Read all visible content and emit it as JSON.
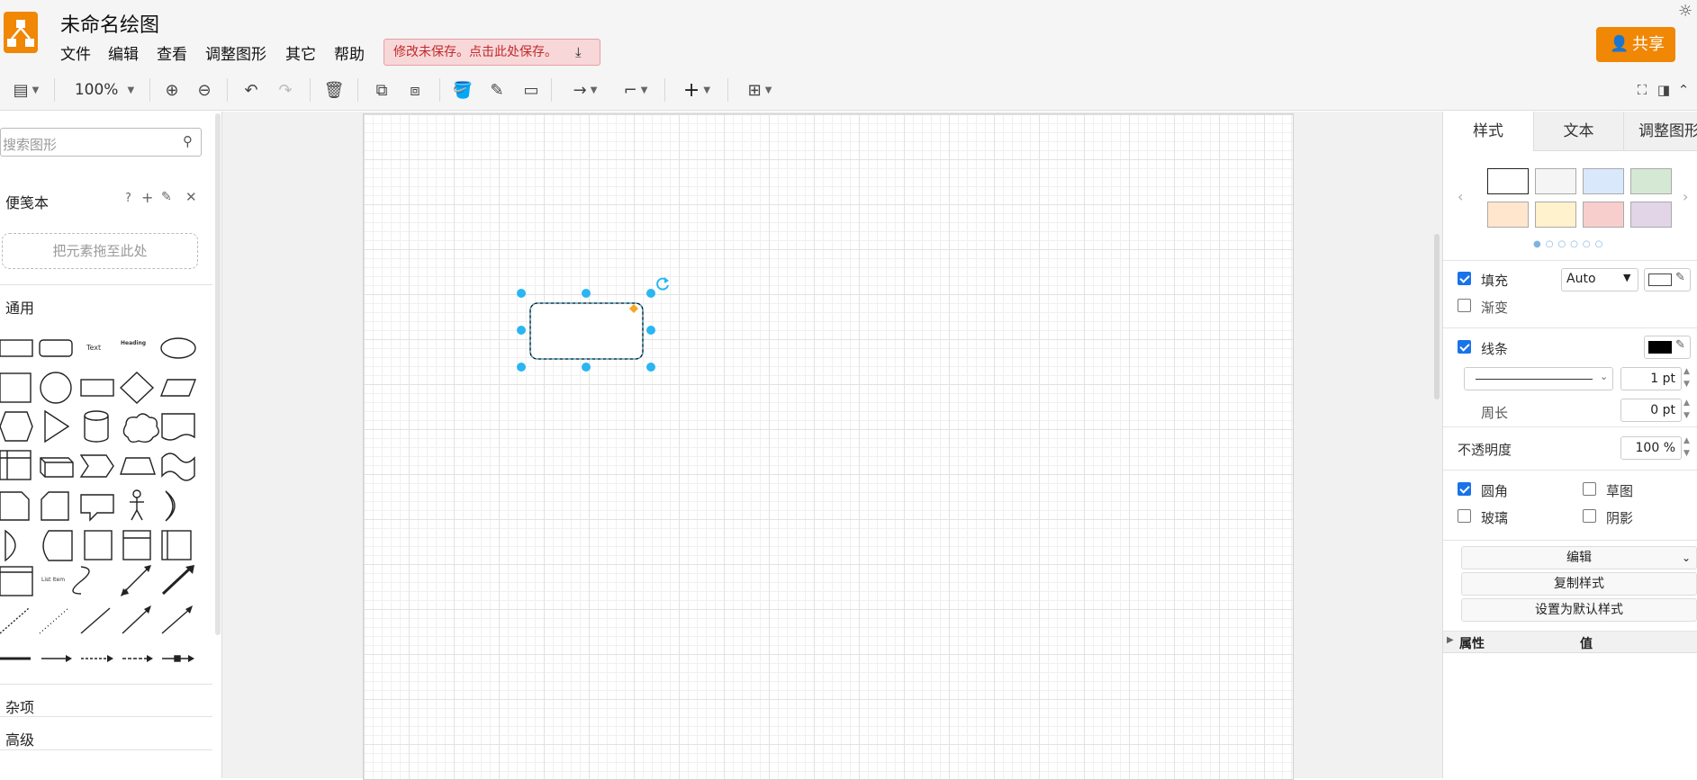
{
  "app": {
    "title": "未命名绘图",
    "menu": [
      "文件",
      "编辑",
      "查看",
      "调整图形",
      "其它",
      "帮助"
    ],
    "unsaved_notice": "修改未保存。点击此处保存。",
    "share_label": "共享"
  },
  "toolbar": {
    "zoom": "100%"
  },
  "left_panel": {
    "search_placeholder": "搜索图形",
    "scratchpad_title": "便笺本",
    "scratchpad_help": "?",
    "scratchpad_drop": "把元素拖至此处",
    "general_title": "通用",
    "misc_title": "杂项",
    "advanced_title": "高级",
    "shape_text": "Text",
    "shape_heading": "Heading",
    "shape_list_item": "List Item"
  },
  "right_panel": {
    "tabs": [
      "样式",
      "文本",
      "调整图形"
    ],
    "swatches": [
      "#ffffff",
      "#f5f5f5",
      "#dae8fc",
      "#d5e8d4",
      "#ffe6cc",
      "#fff2cc",
      "#f8cecc",
      "#e1d5e7"
    ],
    "fill_label": "填充",
    "fill_mode": "Auto",
    "gradient_label": "渐变",
    "stroke_label": "线条",
    "stroke_width": "1 pt",
    "perimeter_label": "周长",
    "perimeter_value": "0 pt",
    "opacity_label": "不透明度",
    "opacity_value": "100 %",
    "rounded_label": "圆角",
    "sketch_label": "草图",
    "glass_label": "玻璃",
    "shadow_label": "阴影",
    "edit_label": "编辑",
    "copy_style_label": "复制样式",
    "set_default_label": "设置为默认样式",
    "props_header": "属性",
    "value_header": "值"
  }
}
